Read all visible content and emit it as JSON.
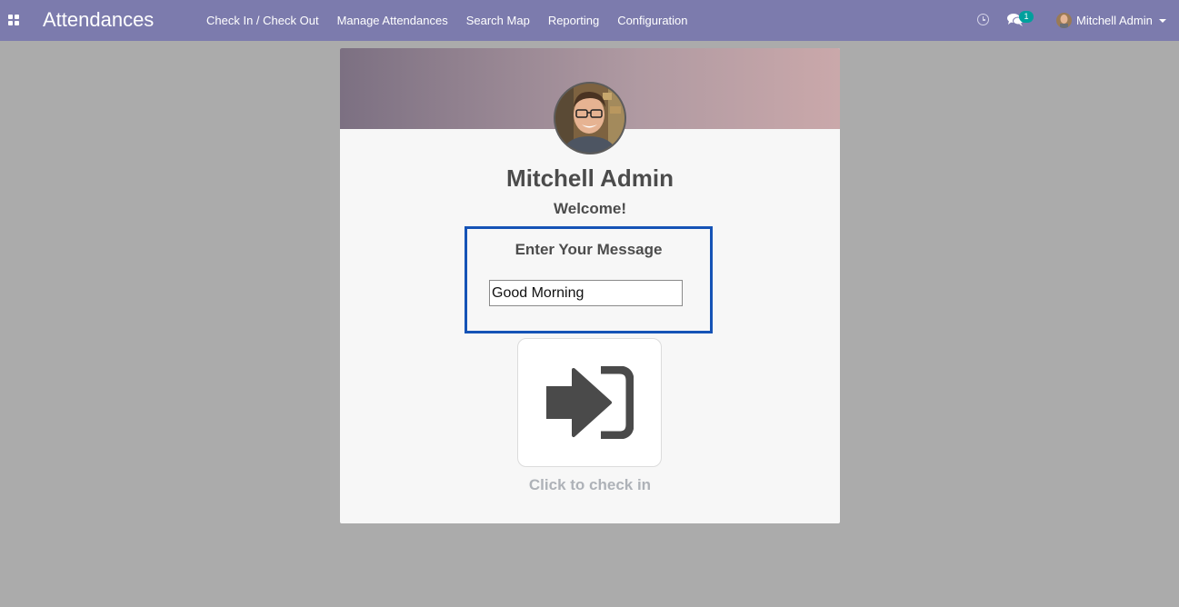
{
  "navbar": {
    "apps_icon": "apps-grid-icon",
    "brand": "Attendances",
    "menu": [
      {
        "label": "Check In / Check Out"
      },
      {
        "label": "Manage Attendances"
      },
      {
        "label": "Search Map"
      },
      {
        "label": "Reporting"
      },
      {
        "label": "Configuration"
      }
    ],
    "systray": {
      "activity_icon": "clock-icon",
      "messages_icon": "comments-icon",
      "messages_count": "1",
      "user_name": "Mitchell Admin"
    },
    "color": "#7c7bad"
  },
  "card": {
    "employee_name": "Mitchell Admin",
    "greeting": "Welcome!",
    "message_box": {
      "title": "Enter Your Message",
      "value": "Good Morning",
      "border_color": "#1553b6"
    },
    "checkin_icon": "sign-in-icon",
    "checkin_label": "Click to check in"
  }
}
